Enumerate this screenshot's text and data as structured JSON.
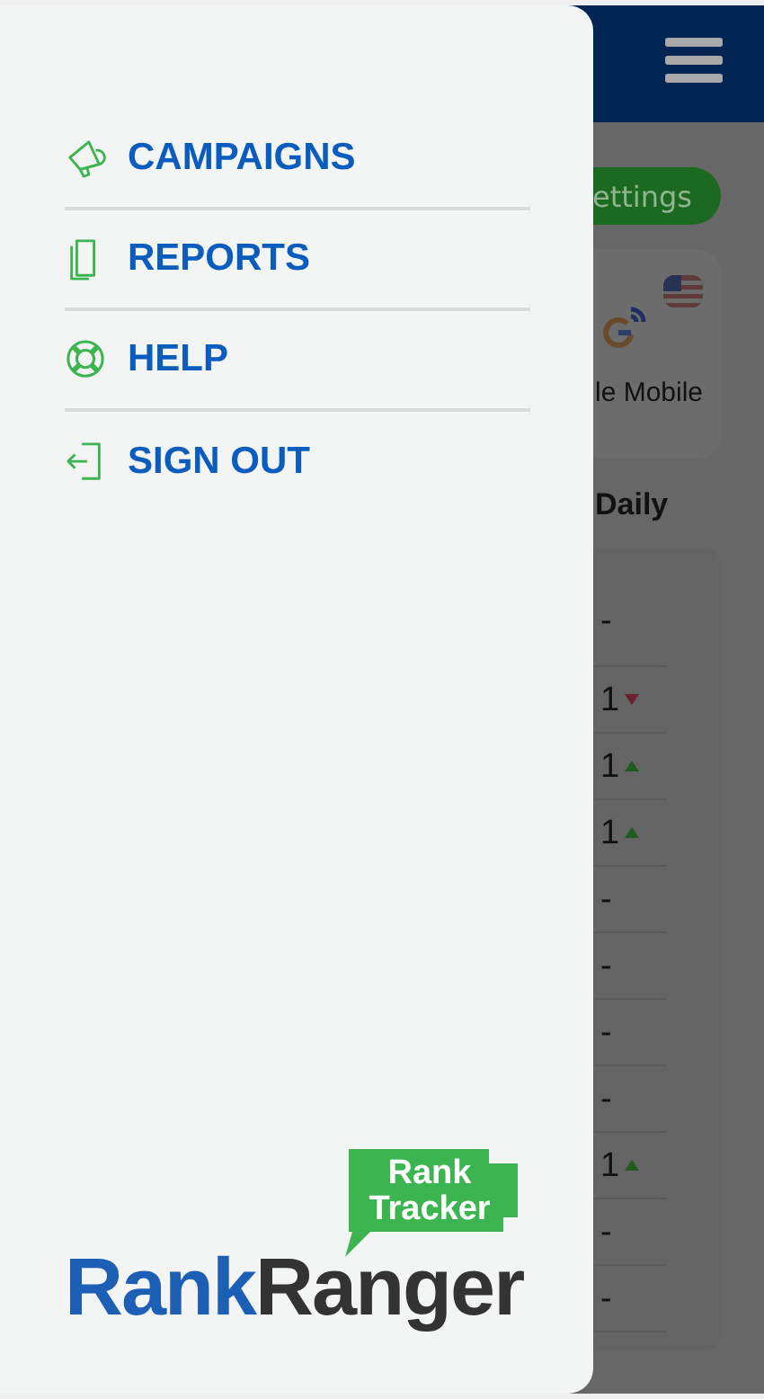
{
  "menu": {
    "items": [
      {
        "label": "CAMPAIGNS"
      },
      {
        "label": "REPORTS"
      },
      {
        "label": "HELP"
      },
      {
        "label": "SIGN OUT"
      }
    ]
  },
  "logo": {
    "badge_lines": [
      "Rank",
      "Tracker"
    ],
    "wordmark": [
      "Rank",
      "Ranger"
    ]
  },
  "background": {
    "settings_button": "ettings",
    "engine_label": "le Mobile",
    "section_title": "Daily",
    "rows": [
      {
        "value": "-",
        "kind": "plain"
      },
      {
        "value": "1",
        "kind": "fall"
      },
      {
        "value": "1",
        "kind": "rise"
      },
      {
        "value": "1",
        "kind": "rise"
      },
      {
        "value": "-",
        "kind": "plain"
      },
      {
        "value": "-",
        "kind": "plain"
      },
      {
        "value": "-",
        "kind": "plain"
      },
      {
        "value": "-",
        "kind": "plain"
      },
      {
        "value": "1",
        "kind": "rise"
      },
      {
        "value": "-",
        "kind": "plain"
      },
      {
        "value": "-",
        "kind": "plain"
      }
    ]
  }
}
